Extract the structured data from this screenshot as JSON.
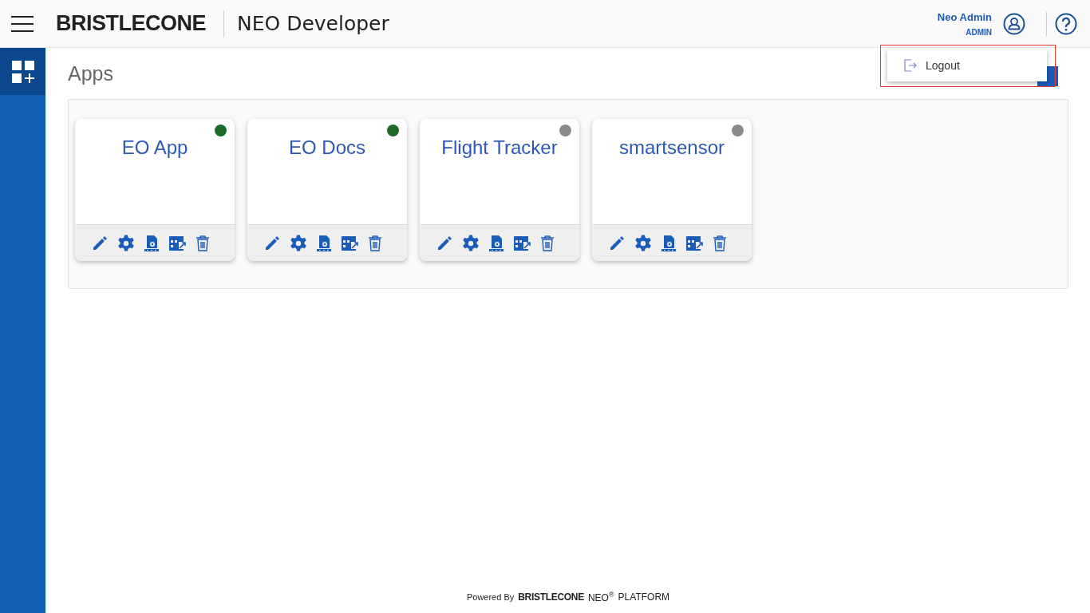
{
  "header": {
    "brand": "BRISTLECONE",
    "product": "NEO Developer",
    "user": {
      "name": "Neo Admin",
      "role": "ADMIN"
    }
  },
  "user_menu": {
    "items": [
      "Logout"
    ]
  },
  "page": {
    "title": "Apps"
  },
  "apps": [
    {
      "name": "EO App",
      "color": "#1b6b26"
    },
    {
      "name": "EO Docs",
      "color": "#1b6b26"
    },
    {
      "name": "Flight Tracker",
      "color": "#8a8a8a"
    },
    {
      "name": "smartsensor",
      "color": "#8a8a8a"
    }
  ],
  "footer": {
    "powered_by": "Powered By",
    "brand": "BRISTLECONE",
    "neo": "NEO$^{®}$",
    "platform": "PLATFORM"
  }
}
